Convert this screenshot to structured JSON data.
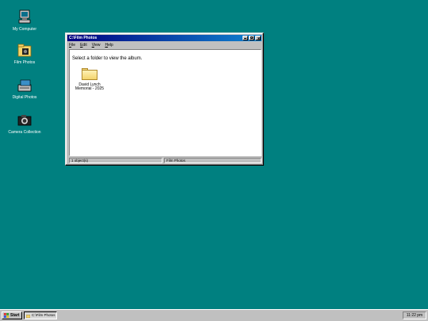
{
  "desktop": {
    "icons": [
      {
        "label": "My Computer"
      },
      {
        "label": "Film Photos"
      },
      {
        "label": "Digital Photos"
      },
      {
        "label": "Camera Collection"
      }
    ]
  },
  "window": {
    "title": "C:\\Film Photos",
    "menu": [
      {
        "accel": "F",
        "rest": "ile"
      },
      {
        "accel": "E",
        "rest": "dit"
      },
      {
        "accel": "V",
        "rest": "iew"
      },
      {
        "accel": "H",
        "rest": "elp"
      }
    ],
    "prompt": "Select a folder to view the album.",
    "folders": [
      {
        "label": "David Lynch Memorial - 2025"
      }
    ],
    "status": {
      "count": "1 object(s)",
      "location": "Film Photos"
    }
  },
  "taskbar": {
    "start_label": "Start",
    "task_label": "C:\\Film Photos",
    "clock": "11:22 pm"
  },
  "colors": {
    "desktop": "#008080",
    "title_active": "#000080"
  }
}
